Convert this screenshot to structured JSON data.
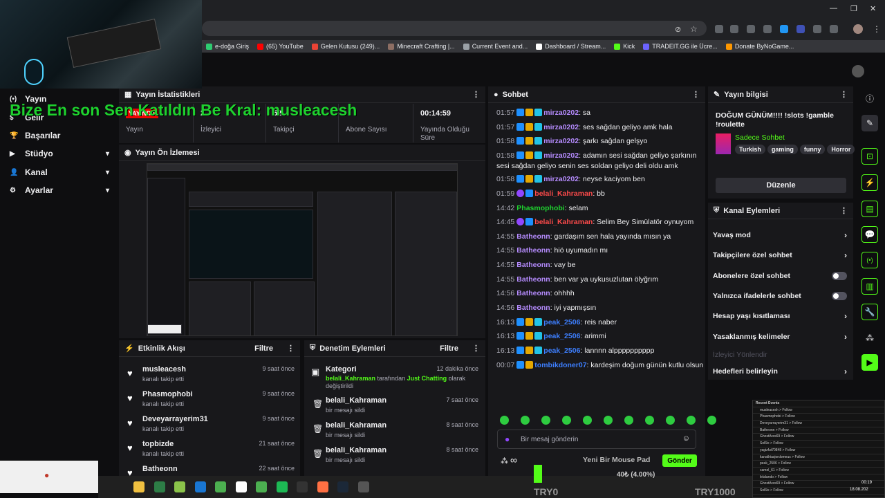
{
  "browser": {
    "bookmarks": [
      {
        "label": "e-doğa Giriş",
        "color": "#2ecc71"
      },
      {
        "label": "(65) YouTube",
        "color": "#ff0000"
      },
      {
        "label": "Gelen Kutusu (249)...",
        "color": "#ea4335"
      },
      {
        "label": "Minecraft Crafting |...",
        "color": "#8d6e63"
      },
      {
        "label": "Current Event and...",
        "color": "#9aa0a6"
      },
      {
        "label": "Dashboard / Stream...",
        "color": "#ffffff"
      },
      {
        "label": "Kick",
        "color": "#53fc18"
      },
      {
        "label": "TRADEIT.GG ile Ücre...",
        "color": "#6c63ff"
      },
      {
        "label": "Donate ByNoGame...",
        "color": "#ff9800"
      }
    ]
  },
  "banner": "Bize En son Sen Katıldın Be Kral: musleacesh",
  "nav": {
    "items": [
      {
        "label": "Yayın",
        "icon": "broadcast-icon",
        "glyph": "(•)"
      },
      {
        "label": "Gelir",
        "icon": "dollar-icon",
        "glyph": "$"
      },
      {
        "label": "Başarılar",
        "icon": "trophy-icon",
        "glyph": "🏆"
      },
      {
        "label": "Stüdyo",
        "icon": "video-icon",
        "glyph": "▶"
      },
      {
        "label": "Kanal",
        "icon": "user-icon",
        "glyph": "👤"
      },
      {
        "label": "Ayarlar",
        "icon": "gear-icon",
        "glyph": "⚙"
      }
    ]
  },
  "stats": {
    "title": "Yayın İstatistikleri",
    "live_badge": "YAYINDA",
    "cells": [
      {
        "value": "",
        "label": "Yayın"
      },
      {
        "value": "2",
        "label": "İzleyici"
      },
      {
        "value": "52",
        "label": "Takipçi"
      },
      {
        "value": "",
        "label": "Abone Sayısı"
      },
      {
        "value": "00:14:59",
        "label": "Yayında Olduğu Süre"
      }
    ]
  },
  "preview": {
    "title": "Yayın Ön İzlemesi"
  },
  "activity": {
    "title": "Etkinlik Akışı",
    "filter": "Filtre",
    "items": [
      {
        "name": "musleacesh",
        "sub": "kanalı takip etti",
        "time": "9 saat önce"
      },
      {
        "name": "Phasmophobi",
        "sub": "kanalı takip etti",
        "time": "9 saat önce"
      },
      {
        "name": "Deveyarrayerim31",
        "sub": "kanalı takip etti",
        "time": "9 saat önce"
      },
      {
        "name": "topbizde",
        "sub": "kanalı takip etti",
        "time": "21 saat önce"
      },
      {
        "name": "Batheonn",
        "sub": "",
        "time": "22 saat önce"
      }
    ]
  },
  "moderation": {
    "title": "Denetim Eylemleri",
    "filter": "Filtre",
    "first": {
      "title": "Kategori",
      "time": "12 dakika önce",
      "user": "belali_Kahraman",
      "mid": "tarafından",
      "cat": "Just Chatting",
      "tail": "olarak değiştirildi"
    },
    "items": [
      {
        "name": "belali_Kahraman",
        "sub": "bir mesajı sildi",
        "time": "7 saat önce"
      },
      {
        "name": "belali_Kahraman",
        "sub": "bir mesajı sildi",
        "time": "8 saat önce"
      },
      {
        "name": "belali_Kahraman",
        "sub": "bir mesajı sildi",
        "time": "8 saat önce"
      }
    ]
  },
  "chat": {
    "title": "Sohbet",
    "placeholder": "Bir mesaj gönderin",
    "send": "Gönder",
    "messages": [
      {
        "time": "01:57",
        "badges": [
          "blue",
          "gold",
          "cyan"
        ],
        "user": "mirza0202",
        "color": "#b68cff",
        "text": "sa"
      },
      {
        "time": "01:57",
        "badges": [
          "blue",
          "gold",
          "cyan"
        ],
        "user": "mirza0202",
        "color": "#b68cff",
        "text": "ses sağdan geliyo amk hala"
      },
      {
        "time": "01:58",
        "badges": [
          "blue",
          "gold",
          "cyan"
        ],
        "user": "mirza0202",
        "color": "#b68cff",
        "text": "şarkı sağdan gelşyo"
      },
      {
        "time": "01:58",
        "badges": [
          "blue",
          "gold",
          "cyan"
        ],
        "user": "mirza0202",
        "color": "#b68cff",
        "text": "adamın sesi sağdan geliyo şarkının sesi sağdan geliyo senin ses soldan geliyo deli oldu amk"
      },
      {
        "time": "01:58",
        "badges": [
          "blue",
          "gold",
          "cyan"
        ],
        "user": "mirza0202",
        "color": "#b68cff",
        "text": "neyse kaciyom ben"
      },
      {
        "time": "01:59",
        "badges": [
          "purple",
          "blue"
        ],
        "user": "belali_Kahraman",
        "color": "#ff4b4b",
        "text": "bb"
      },
      {
        "time": "14:42",
        "badges": [],
        "user": "Phasmophobi",
        "color": "#1ed12e",
        "text": "selam"
      },
      {
        "time": "14:45",
        "badges": [
          "purple",
          "blue"
        ],
        "user": "belali_Kahraman",
        "color": "#ff4b4b",
        "text": "Selim Bey Simülatör oynuyom"
      },
      {
        "time": "14:55",
        "badges": [],
        "user": "Batheonn",
        "color": "#b68cff",
        "text": "gardaşım sen hala yayında mısın ya"
      },
      {
        "time": "14:55",
        "badges": [],
        "user": "Batheonn",
        "color": "#b68cff",
        "text": "hiö uyumadın mı"
      },
      {
        "time": "14:55",
        "badges": [],
        "user": "Batheonn",
        "color": "#b68cff",
        "text": "vay be"
      },
      {
        "time": "14:55",
        "badges": [],
        "user": "Batheonn",
        "color": "#b68cff",
        "text": "ben var ya uykusuzlutan ölyğrım"
      },
      {
        "time": "14:56",
        "badges": [],
        "user": "Batheonn",
        "color": "#b68cff",
        "text": "ohhhh"
      },
      {
        "time": "14:56",
        "badges": [],
        "user": "Batheonn",
        "color": "#b68cff",
        "text": "iyi yapmışsın"
      },
      {
        "time": "16:13",
        "badges": [
          "blue",
          "gold",
          "cyan"
        ],
        "user": "peak_2506",
        "color": "#3d7fff",
        "text": "reis naber"
      },
      {
        "time": "16:13",
        "badges": [
          "blue",
          "gold",
          "cyan"
        ],
        "user": "peak_2506",
        "color": "#3d7fff",
        "text": "arimmi"
      },
      {
        "time": "16:13",
        "badges": [
          "blue",
          "gold",
          "cyan"
        ],
        "user": "peak_2506",
        "color": "#3d7fff",
        "text": "lannnn alpppppppppp"
      },
      {
        "time": "00:07",
        "badges": [
          "blue",
          "gold"
        ],
        "user": "tombikdoner07",
        "color": "#3d7fff",
        "text": "kardeşim doğum günün kutlu olsun"
      }
    ]
  },
  "stream_info": {
    "title": "Yayın bilgisi",
    "stream_title": "DOĞUM GÜNÜM!!!! !slots !gamble !roulette",
    "category": "Sadece Sohbet",
    "tags": [
      "Turkish",
      "gaming",
      "funny",
      "Horror"
    ],
    "edit": "Düzenle"
  },
  "channel_actions": {
    "title": "Kanal Eylemleri",
    "rows": [
      {
        "label": "Yavaş mod",
        "kind": "chev"
      },
      {
        "label": "Takipçilere özel sohbet",
        "kind": "chev"
      },
      {
        "label": "Abonelere özel sohbet",
        "kind": "toggle"
      },
      {
        "label": "Yalnızca ifadelerle sohbet",
        "kind": "toggle"
      },
      {
        "label": "Hesap yaşı kısıtlaması",
        "kind": "chev"
      },
      {
        "label": "Yasaklanmış kelimeler",
        "kind": "chev"
      },
      {
        "label": "İzleyici Yönlendir",
        "kind": "disabled"
      },
      {
        "label": "Hedefleri belirleyin",
        "kind": "chev"
      }
    ]
  },
  "overlay": {
    "goal_text": "Yeni Bir Mouse Pad",
    "goal_amount": "40₺ (4.00%)",
    "goal_progress": 0.04,
    "left_label": "TRY0",
    "right_label": "TRY1000",
    "recent_title": "Recent Events",
    "recent_rows": [
      "musleacesh > Follow",
      "Phasmophobi > Follow",
      "Deveyarrayerim31 > Follow",
      "Batheonn > Follow",
      "GhostAres69 > Follow",
      "Sol6ix > Follow",
      "yagizfut70848 > Follow",
      "kanathiasjordomeus > Follow",
      "peak_2506 > Follow",
      "camel_61 > Follow",
      "lelalando > Follow",
      "GhostAres69 > Follow",
      "Sol6ix > Follow"
    ]
  },
  "taskbar": {
    "time": "00:19",
    "date": "18.08.202"
  },
  "colors": {
    "accent": "#53fc18",
    "live": "#eb0400",
    "panel": "#18181b",
    "bg": "#0e0e10"
  }
}
